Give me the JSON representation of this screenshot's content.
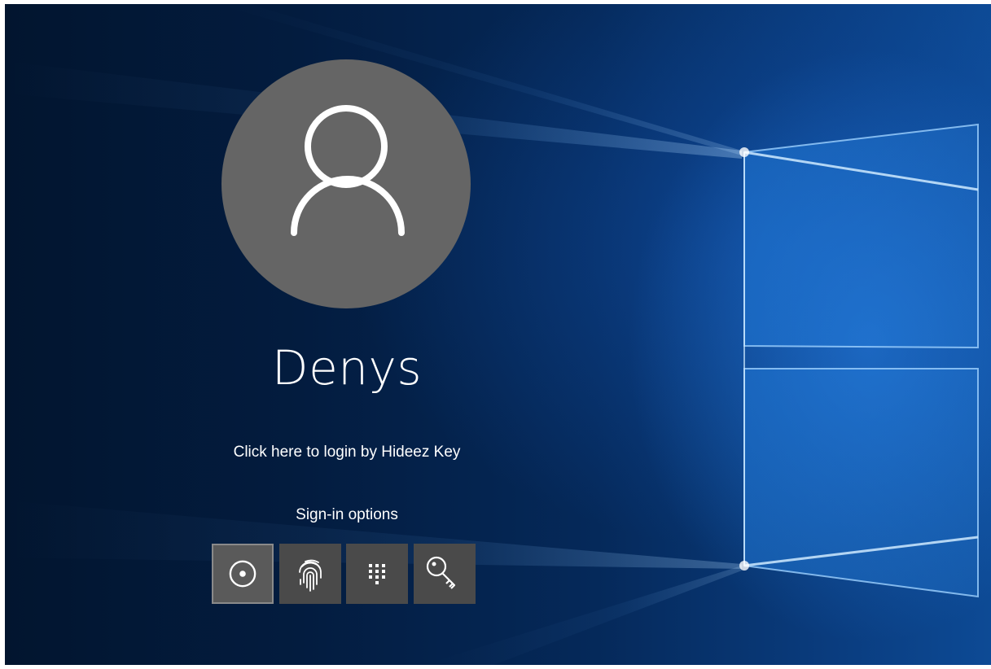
{
  "user": {
    "name": "Denys"
  },
  "links": {
    "hideez_login": "Click here to login by Hideez Key"
  },
  "signin": {
    "title": "Sign-in options",
    "options": [
      {
        "icon": "hideez-key-icon",
        "selected": true
      },
      {
        "icon": "fingerprint-icon",
        "selected": false
      },
      {
        "icon": "pin-keypad-icon",
        "selected": false
      },
      {
        "icon": "password-key-icon",
        "selected": false
      }
    ]
  },
  "colors": {
    "avatar_bg": "#656565",
    "tile_bg": "#4a4a4a",
    "selected_border": "#8a8a8a"
  }
}
